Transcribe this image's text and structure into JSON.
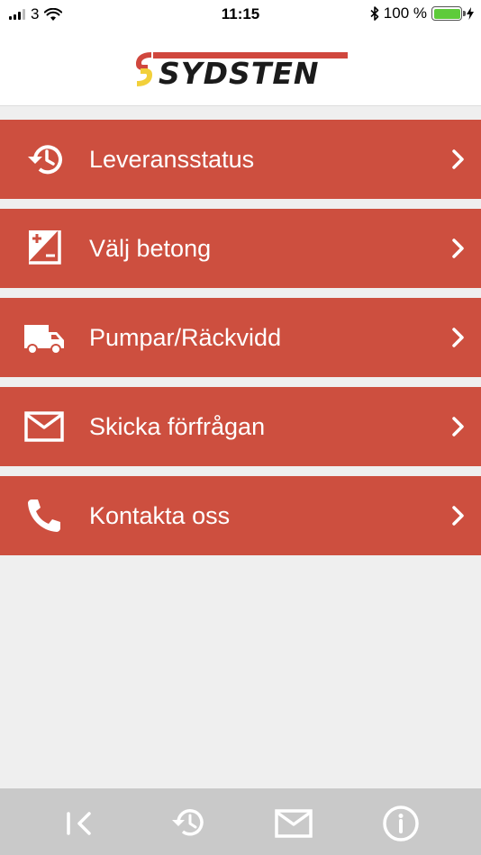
{
  "status_bar": {
    "carrier": "3",
    "time": "11:15",
    "battery_percent": "100 %",
    "battery_level": 1.0,
    "icons": [
      "cellular-signal-icon",
      "wifi-icon",
      "bluetooth-icon",
      "battery-icon",
      "charging-bolt-icon"
    ]
  },
  "header": {
    "logo_text": "SYDSTEN",
    "logo_colors": {
      "bar": "#d0473d",
      "mark_red": "#d0473d",
      "mark_yellow": "#f2d03a",
      "text": "#1b1b1b"
    }
  },
  "menu": {
    "items": [
      {
        "label": "Leveransstatus",
        "icon": "history-icon"
      },
      {
        "label": "Välj betong",
        "icon": "exposure-plus-minus-icon"
      },
      {
        "label": "Pumpar/Räckvidd",
        "icon": "truck-icon"
      },
      {
        "label": "Skicka förfrågan",
        "icon": "envelope-icon"
      },
      {
        "label": "Kontakta oss",
        "icon": "phone-icon"
      }
    ],
    "item_color": "#cd4f3f",
    "chevron_icon": "chevron-right-icon"
  },
  "tab_bar": {
    "tabs": [
      {
        "icon": "back-to-start-icon"
      },
      {
        "icon": "history-icon"
      },
      {
        "icon": "envelope-icon"
      },
      {
        "icon": "info-icon"
      }
    ],
    "background": "#c9c9c9"
  },
  "colors": {
    "page_background": "#efefef",
    "battery_green": "#5ecb3b"
  }
}
